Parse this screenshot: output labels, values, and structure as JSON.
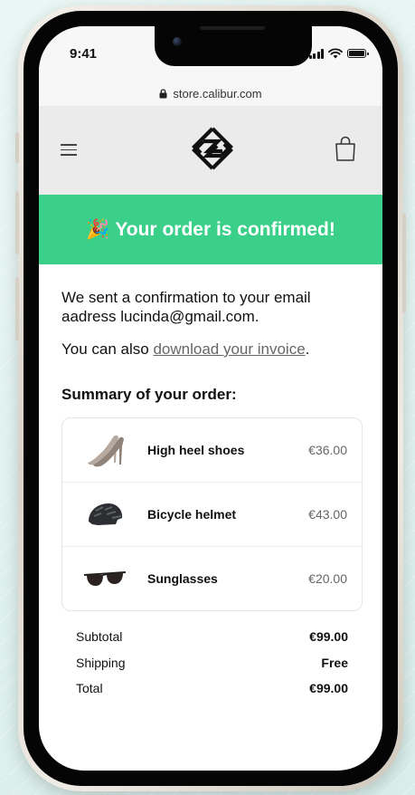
{
  "status_bar": {
    "time": "9:41"
  },
  "browser": {
    "url": "store.calibur.com"
  },
  "header": {
    "menu_icon": "hamburger-menu-icon",
    "logo": "calibur-logo",
    "cart_icon": "shopping-bag-icon"
  },
  "banner": {
    "icon": "party-popper-icon",
    "text": "Your order is confirmed!",
    "color": "#3ad08a"
  },
  "message": {
    "line1": "We sent a confirmation to your email aadress lucinda@gmail.com.",
    "line2_prefix": "You can also ",
    "invoice_link": "download your invoice",
    "line2_suffix": "."
  },
  "summary": {
    "title": "Summary of your order:",
    "items": [
      {
        "name": "High heel shoes",
        "price": "€36.00",
        "image": "high-heel-shoes"
      },
      {
        "name": "Bicycle helmet",
        "price": "€43.00",
        "image": "bicycle-helmet"
      },
      {
        "name": "Sunglasses",
        "price": "€20.00",
        "image": "sunglasses"
      }
    ]
  },
  "totals": {
    "subtotal_label": "Subtotal",
    "subtotal": "€99.00",
    "shipping_label": "Shipping",
    "shipping": "Free",
    "total_label": "Total",
    "total": "€99.00"
  }
}
